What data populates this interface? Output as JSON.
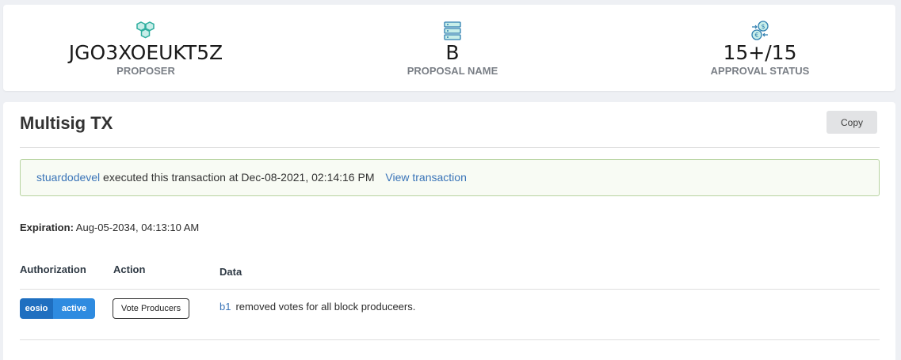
{
  "stats": {
    "proposer": {
      "value": "JGO3XOEUKT5Z",
      "label": "PROPOSER",
      "icon": "hexagon-cluster-icon"
    },
    "proposal_name": {
      "value": "B",
      "label": "PROPOSAL NAME",
      "icon": "server-stack-icon"
    },
    "approval_status": {
      "value": "15+/15",
      "label": "APPROVAL STATUS",
      "icon": "currency-exchange-icon"
    }
  },
  "main": {
    "title": "Multisig TX",
    "copy_label": "Copy",
    "alert": {
      "actor": "stuardodevel",
      "message": " executed this transaction at Dec-08-2021, 02:14:16 PM",
      "link_label": "View transaction"
    },
    "expiration": {
      "label": "Expiration:",
      "value": " Aug-05-2034, 04:13:10 AM"
    },
    "table": {
      "headers": {
        "authorization": "Authorization",
        "action": "Action",
        "data": "Data"
      },
      "rows": [
        {
          "auth_actor": "eosio",
          "auth_permission": "active",
          "action": "Vote Producers",
          "data_account": "b1",
          "data_text": "removed votes for all block produceers."
        }
      ]
    }
  },
  "colors": {
    "accent": "#1f6fc0",
    "link": "#3a74b8",
    "success_border": "#b7d3a0",
    "icon_teal": "#3bbfb0"
  }
}
